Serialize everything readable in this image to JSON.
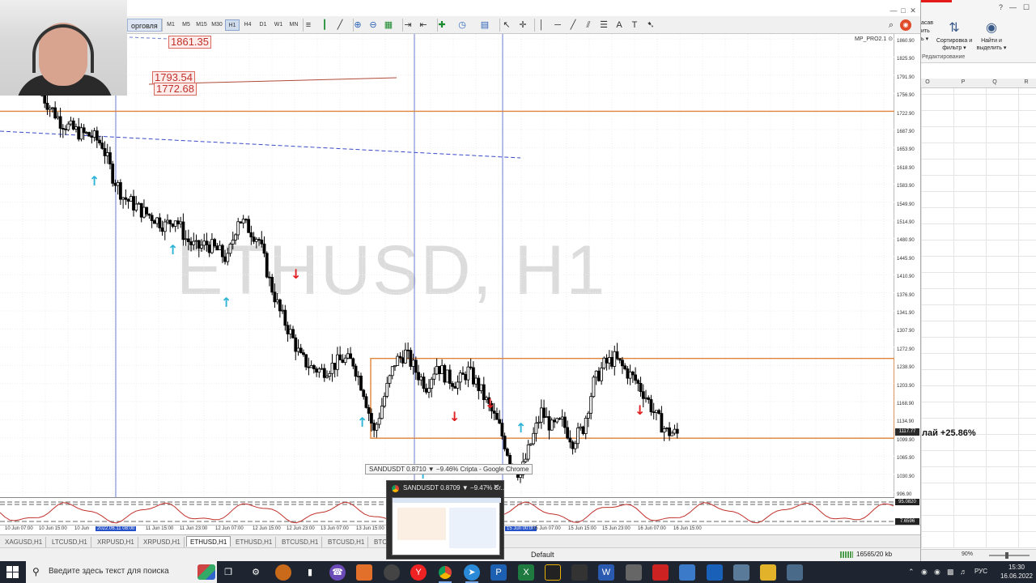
{
  "mt": {
    "menu_label": "орговля",
    "timeframes": [
      "M1",
      "M5",
      "M15",
      "M30",
      "H1",
      "H4",
      "D1",
      "W1",
      "MN"
    ],
    "active_timeframe": "H1",
    "indicator_name": "MP_PRO2.1 ⊙",
    "watermark": "ETHUSD, H1",
    "horizontal_labels": [
      "1861.35",
      "1793.54",
      "1772.68"
    ],
    "price_ticks": [
      "1860.90",
      "1825.90",
      "1791.90",
      "1756.90",
      "1722.90",
      "1687.90",
      "1653.90",
      "1618.90",
      "1583.90",
      "1549.90",
      "1514.90",
      "1480.90",
      "1445.90",
      "1410.90",
      "1376.90",
      "1341.90",
      "1307.90",
      "1272.90",
      "1238.90",
      "1203.90",
      "1168.90",
      "1134.90",
      "1099.90",
      "1065.90",
      "1030.90",
      "996.90"
    ],
    "current_price": "1117.77",
    "indicator_scale": [
      "95.0820",
      "7.6596"
    ],
    "time_ticks": [
      "10 Jun 07:00",
      "10 Jun 15:00",
      "10 Jun",
      "2022.06.11 08:00",
      "11 Jun 15:00",
      "11 Jun 23:00",
      "12 Jun 07:00",
      "12 Jun 15:00",
      "12 Jun 23:00",
      "13 Jun 07:00",
      "13 Jun 15:00",
      "15 Jun 00:00",
      "15 Jun 07:00",
      "15 Jun 15:00",
      "15 Jun 23:00",
      "16 Jun 07:00",
      "16 Jun 15:00"
    ],
    "symbol_tabs": [
      "XAGUSD,H1",
      "LTCUSD,H1",
      "XRPUSD,H1",
      "XRPUSD,H1",
      "ETHUSD,H1",
      "ETHUSD,H1",
      "BTCUSD,H1",
      "BTCUSD,H1",
      "BTC"
    ],
    "active_tab": "ETHUSD,H1",
    "status_profile": "Default",
    "status_traffic": "16565/20 kb"
  },
  "chart_data": {
    "type": "candlestick",
    "title": "ETHUSD, H1",
    "ylim": [
      996.9,
      1860.9
    ],
    "close_trend": [
      1760,
      1732,
      1704,
      1690,
      1680,
      1676,
      1660,
      1600,
      1560,
      1545,
      1530,
      1520,
      1505,
      1520,
      1480,
      1462,
      1470,
      1458,
      1440,
      1520,
      1500,
      1478,
      1400,
      1340,
      1300,
      1252,
      1235,
      1228,
      1238,
      1250,
      1245,
      1190,
      1110,
      1180,
      1245,
      1262,
      1228,
      1200,
      1240,
      1215,
      1205,
      1228,
      1198,
      1160,
      1120,
      1060,
      1030,
      1090,
      1150,
      1120,
      1130,
      1095,
      1120,
      1205,
      1240,
      1252,
      1230,
      1210,
      1180,
      1140,
      1112,
      1108
    ],
    "levels": [
      1722.9,
      1252,
      1100
    ]
  },
  "excel": {
    "topbar": [
      "?",
      "—",
      "☐",
      "✕"
    ],
    "ribbon_left": [
      "асав",
      "ить",
      "ь ▾"
    ],
    "sort_filter": "Сортировка и фильтр ▾",
    "find_select": "Найти и выделить ▾",
    "group_label": "Редактирование",
    "columns": [
      "O",
      "P",
      "Q",
      "R"
    ],
    "cell_text": "лай +25.86%",
    "zoom": "90%"
  },
  "chrome": {
    "tooltip": "SANDUSDT 0.8710 ▼ −9.46% Cripta - Google Chrome",
    "preview_title": "SANDUSDT 0.8709 ▼ −9.47% Cr..."
  },
  "taskbar": {
    "search_placeholder": "Введите здесь текст для поиска",
    "lang": "РУС",
    "time": "15:30",
    "date": "16.06.2022"
  }
}
